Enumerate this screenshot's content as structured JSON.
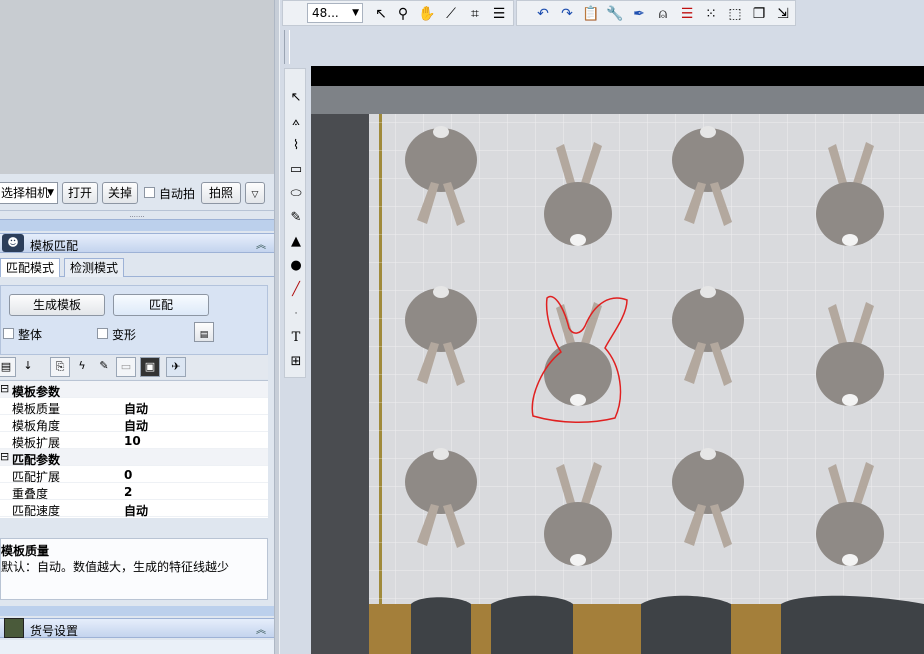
{
  "camera": {
    "select_label": "选择相机",
    "open_label": "打开",
    "close_label": "关掉",
    "auto_capture_label": "自动拍",
    "capture_label": "拍照"
  },
  "template_panel": {
    "title": "模板匹配",
    "tabs": [
      "匹配模式",
      "检测模式"
    ],
    "generate_label": "生成模板",
    "match_label": "匹配",
    "whole_label": "整体",
    "deform_label": "变形"
  },
  "properties": {
    "groups": [
      {
        "name": "模板参数",
        "rows": [
          {
            "key": "模板质量",
            "value": "自动"
          },
          {
            "key": "模板角度",
            "value": "自动"
          },
          {
            "key": "模板扩展",
            "value": "10"
          }
        ]
      },
      {
        "name": "匹配参数",
        "rows": [
          {
            "key": "匹配扩展",
            "value": "0"
          },
          {
            "key": "重叠度",
            "value": "2"
          },
          {
            "key": "匹配速度",
            "value": "自动"
          }
        ]
      }
    ],
    "description_title": "模板质量",
    "description_text": "默认：自动。数值越大，生成的特征线越少"
  },
  "sku_panel": {
    "title": "货号设置"
  },
  "toolbar": {
    "zoom_value": "48..."
  },
  "colors": {
    "panel_blue": "#c4d4ee",
    "outline_red": "#e02020",
    "fabric": "#d9dadd"
  }
}
